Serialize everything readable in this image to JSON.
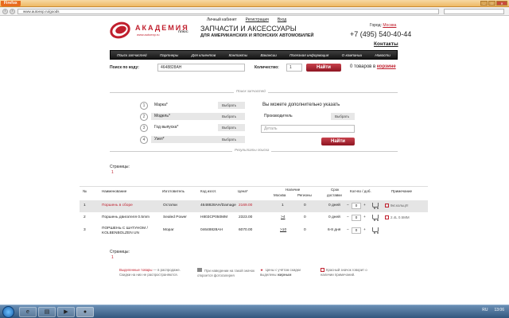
{
  "browser": {
    "app_button": "Firefox",
    "url": "www.autoexp.ru/goods"
  },
  "header": {
    "links": [
      "Личный кабинет",
      "Регистрация",
      "Вход"
    ],
    "logo_name": "АКАДЕМИЯ",
    "logo_sub": "ПЛЮС",
    "logo_url": "www.autoexp.ru",
    "tagline1": "ЗАПЧАСТИ И АКСЕССУАРЫ",
    "tagline2": "ДЛЯ АМЕРИКАНСКИХ И ЯПОНСКИХ АВТОМОБИЛЕЙ",
    "city_label": "Город:",
    "city": "Москва",
    "phone": "+7 (495) 540-40-44",
    "contacts": "Контакты"
  },
  "menu": [
    "Поиск запчастей",
    "Партнеры",
    "Для клиентов",
    "Контакты",
    "Вакансии",
    "Полезная информация",
    "О компании",
    "Новости"
  ],
  "search": {
    "code_label": "Поиск по коду:",
    "code_value": "4648828AH",
    "qty_label": "Количество:",
    "qty_value": "1",
    "button": "Найти",
    "cart_text": "0 товаров в",
    "cart_link": "корзине"
  },
  "parts_search": {
    "section_label": "Поиск запчастей",
    "fields": [
      {
        "num": "1",
        "label": "Марка*",
        "action": "Выбрать"
      },
      {
        "num": "2",
        "label": "Модель*",
        "action": "Выбрать"
      },
      {
        "num": "3",
        "label": "Год выпуска*",
        "action": "Выбрать"
      },
      {
        "num": "4",
        "label": "Узел*",
        "action": "Выбрать"
      }
    ],
    "extra_title": "Вы можете дополнительно указать",
    "manufacturer_label": "Производитель",
    "manufacturer_action": "Выбрать",
    "detail_placeholder": "Деталь",
    "button": "Найти",
    "results_label": "Результаты поиска"
  },
  "pages": {
    "label": "Страницы:",
    "value": "1"
  },
  "table": {
    "headers": {
      "num": "№",
      "name": "Наименование",
      "maker": "Изготовитель",
      "code": "Код изгот.",
      "price": "Цена*",
      "avail": "Наличие",
      "moscow": "Москва",
      "regions": "Регионы",
      "term1": "Срок",
      "term2": "доставки",
      "qty": "Кол-во / доб.",
      "note": "Примечание"
    },
    "rows": [
      {
        "num": "1",
        "name": "Поршень в сборе",
        "maker": "Остатки",
        "code": "4648828AH/Damage",
        "price": "2169.00",
        "moscow": "1",
        "regions": "0",
        "term": "0 дней",
        "qty": "0",
        "note": "9кг.кольц!!!"
      },
      {
        "num": "2",
        "name": "Поршень двигателя 0.5mm",
        "maker": "Sealed Power",
        "code": "H803CP050MM",
        "price": "2323.00",
        "moscow": ">4",
        "regions": "0",
        "term": "0 дней",
        "qty": "0",
        "note": "2.4L 0.5MM"
      },
      {
        "num": "3",
        "name": "ПОРШЕНЬ С ШАТУНОМ / KOLBENBOLZEN UN",
        "maker": "Mopar",
        "code": "04648828AH",
        "price": "6070.00",
        "moscow": ">10",
        "regions": "0",
        "term": "6-8 дня",
        "qty": "0",
        "note": ""
      }
    ]
  },
  "legend": {
    "l1a": "Выделенные товары",
    "l1b": "— в распродаже.",
    "l1c": "Скидки на них не распространяются.",
    "l2": "При наведении на такой значок откроется фотогалерея",
    "l3a": "Цены с учётом скидки выделены",
    "l3b": "жирным",
    "l4": "Красный значок говорит о наличии примечаний."
  },
  "taskbar": {
    "lang": "RU",
    "time": "13:06"
  }
}
